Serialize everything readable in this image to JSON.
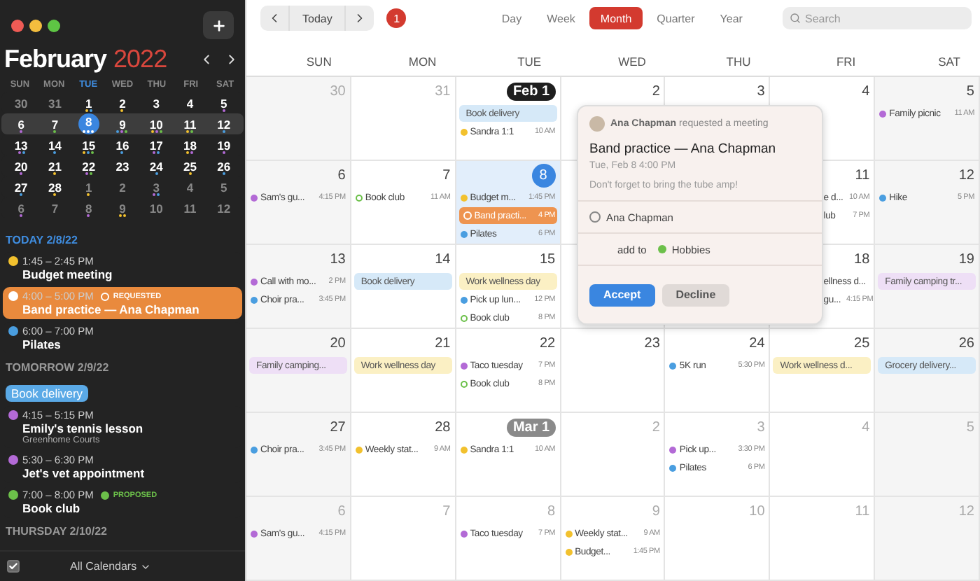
{
  "sidebar": {
    "month": "February",
    "year": "2022",
    "weekdays": [
      {
        "label": "SUN",
        "selected": false
      },
      {
        "label": "MON",
        "selected": false
      },
      {
        "label": "TUE",
        "selected": true
      },
      {
        "label": "WED",
        "selected": false
      },
      {
        "label": "THU",
        "selected": false
      },
      {
        "label": "FRI",
        "selected": false
      },
      {
        "label": "SAT",
        "selected": false
      }
    ],
    "weeks": [
      {
        "current": false,
        "days": [
          {
            "n": "30",
            "dim": true,
            "selected": false
          },
          {
            "n": "31",
            "dim": true,
            "selected": false
          },
          {
            "n": "1",
            "dim": false,
            "selected": false,
            "dots": [
              {
                "color": "#f2c12e"
              },
              {
                "color": "#4a9ee0"
              }
            ]
          },
          {
            "n": "2",
            "dim": false,
            "selected": false,
            "dots": [
              {
                "color": "#f2c12e"
              }
            ]
          },
          {
            "n": "3",
            "dim": false,
            "selected": false
          },
          {
            "n": "4",
            "dim": false,
            "selected": false
          },
          {
            "n": "5",
            "dim": false,
            "selected": false,
            "dots": [
              {
                "color": "#b36ad6"
              }
            ]
          }
        ]
      },
      {
        "current": true,
        "days": [
          {
            "n": "6",
            "dim": false,
            "selected": false,
            "dots": [
              {
                "color": "#b36ad6"
              }
            ]
          },
          {
            "n": "7",
            "dim": false,
            "selected": false,
            "dots": [
              {
                "color": "#6cc04a"
              }
            ]
          },
          {
            "n": "8",
            "dim": false,
            "selected": true,
            "dots": [
              {
                "color": "#ffffff"
              },
              {
                "color": "#ffffff"
              },
              {
                "color": "#ffffff"
              }
            ]
          },
          {
            "n": "9",
            "dim": false,
            "selected": false,
            "dots": [
              {
                "color": "#4a9ee0"
              },
              {
                "color": "#b36ad6"
              },
              {
                "color": "#6cc04a"
              }
            ]
          },
          {
            "n": "10",
            "dim": false,
            "selected": false,
            "dots": [
              {
                "color": "#f2c12e"
              },
              {
                "color": "#b36ad6"
              },
              {
                "color": "#6cc04a"
              }
            ]
          },
          {
            "n": "11",
            "dim": false,
            "selected": false,
            "dots": [
              {
                "color": "#f2c12e"
              },
              {
                "color": "#6cc04a"
              }
            ]
          },
          {
            "n": "12",
            "dim": false,
            "selected": false,
            "dots": [
              {
                "color": "#4a9ee0"
              }
            ]
          }
        ]
      },
      {
        "current": false,
        "days": [
          {
            "n": "13",
            "dim": false,
            "selected": false,
            "dots": [
              {
                "color": "#b36ad6"
              },
              {
                "color": "#4a9ee0"
              }
            ]
          },
          {
            "n": "14",
            "dim": false,
            "selected": false,
            "dots": [
              {
                "color": "#4a9ee0"
              }
            ]
          },
          {
            "n": "15",
            "dim": false,
            "selected": false,
            "dots": [
              {
                "color": "#f2c12e"
              },
              {
                "color": "#4a9ee0"
              },
              {
                "color": "#6cc04a"
              }
            ]
          },
          {
            "n": "16",
            "dim": false,
            "selected": false,
            "dots": [
              {
                "color": "#4a9ee0"
              }
            ]
          },
          {
            "n": "17",
            "dim": false,
            "selected": false,
            "dots": [
              {
                "color": "#b36ad6"
              },
              {
                "color": "#4a9ee0"
              }
            ]
          },
          {
            "n": "18",
            "dim": false,
            "selected": false,
            "dots": [
              {
                "color": "#f2c12e"
              },
              {
                "color": "#b36ad6"
              }
            ]
          },
          {
            "n": "19",
            "dim": false,
            "selected": false,
            "dots": [
              {
                "color": "#b36ad6"
              }
            ]
          }
        ]
      },
      {
        "current": false,
        "days": [
          {
            "n": "20",
            "dim": false,
            "selected": false,
            "dots": [
              {
                "color": "#b36ad6"
              }
            ]
          },
          {
            "n": "21",
            "dim": false,
            "selected": false,
            "dots": [
              {
                "color": "#f2c12e"
              }
            ]
          },
          {
            "n": "22",
            "dim": false,
            "selected": false,
            "dots": [
              {
                "color": "#b36ad6"
              },
              {
                "color": "#6cc04a"
              }
            ]
          },
          {
            "n": "23",
            "dim": false,
            "selected": false
          },
          {
            "n": "24",
            "dim": false,
            "selected": false,
            "dots": [
              {
                "color": "#4a9ee0"
              }
            ]
          },
          {
            "n": "25",
            "dim": false,
            "selected": false,
            "dots": [
              {
                "color": "#f2c12e"
              }
            ]
          },
          {
            "n": "26",
            "dim": false,
            "selected": false,
            "dots": [
              {
                "color": "#4a9ee0"
              }
            ]
          }
        ]
      },
      {
        "current": false,
        "days": [
          {
            "n": "27",
            "dim": false,
            "selected": false,
            "dots": [
              {
                "color": "#4a9ee0"
              }
            ]
          },
          {
            "n": "28",
            "dim": false,
            "selected": false,
            "dots": [
              {
                "color": "#f2c12e"
              }
            ]
          },
          {
            "n": "1",
            "dim": true,
            "selected": false,
            "dots": [
              {
                "color": "#f2c12e"
              }
            ]
          },
          {
            "n": "2",
            "dim": true,
            "selected": false
          },
          {
            "n": "3",
            "dim": true,
            "selected": false,
            "dots": [
              {
                "color": "#b36ad6"
              },
              {
                "color": "#4a9ee0"
              }
            ]
          },
          {
            "n": "4",
            "dim": true,
            "selected": false
          },
          {
            "n": "5",
            "dim": true,
            "selected": false
          }
        ]
      },
      {
        "current": false,
        "days": [
          {
            "n": "6",
            "dim": true,
            "selected": false,
            "dots": [
              {
                "color": "#b36ad6"
              }
            ]
          },
          {
            "n": "7",
            "dim": true,
            "selected": false
          },
          {
            "n": "8",
            "dim": true,
            "selected": false,
            "dots": [
              {
                "color": "#b36ad6"
              }
            ]
          },
          {
            "n": "9",
            "dim": true,
            "selected": false,
            "dots": [
              {
                "color": "#f2c12e"
              },
              {
                "color": "#f2c12e"
              }
            ]
          },
          {
            "n": "10",
            "dim": true,
            "selected": false
          },
          {
            "n": "11",
            "dim": true,
            "selected": false
          },
          {
            "n": "12",
            "dim": true,
            "selected": false
          }
        ]
      }
    ],
    "agenda": [
      {
        "heading": "TODAY 2/8/22",
        "today": true,
        "items": [
          {
            "kind": "event",
            "selected": false,
            "time": "1:45 – 2:45 PM",
            "title": "Budget meeting",
            "color": "#f2c12e"
          },
          {
            "kind": "event",
            "selected": true,
            "time": "4:00 – 5:00 PM",
            "badge": {
              "kind": "requested",
              "label": "REQUESTED"
            },
            "title": "Band practice — Ana Chapman",
            "color": "#ffffff"
          },
          {
            "kind": "event",
            "selected": false,
            "time": "6:00 – 7:00 PM",
            "title": "Pilates",
            "color": "#4a9ee0"
          }
        ]
      },
      {
        "heading": "TOMORROW 2/9/22",
        "today": false,
        "items": [
          {
            "kind": "pill",
            "title": "Book delivery",
            "color": "#5aa9e6"
          },
          {
            "kind": "event",
            "selected": false,
            "time": "4:15 – 5:15 PM",
            "title": "Emily's tennis lesson",
            "note": "Greenhome Courts",
            "color": "#b36ad6"
          },
          {
            "kind": "event",
            "selected": false,
            "time": "5:30 – 6:30 PM",
            "title": "Jet's vet appointment",
            "color": "#b36ad6"
          },
          {
            "kind": "event",
            "selected": false,
            "time": "7:00 – 8:00 PM",
            "badge": {
              "kind": "proposed",
              "label": "PROPOSED"
            },
            "title": "Book club",
            "color": "#6cc04a"
          }
        ]
      },
      {
        "heading": "THURSDAY 2/10/22",
        "today": false
      }
    ],
    "footer": {
      "label": "All Calendars",
      "checked": true
    }
  },
  "toolbar": {
    "today": "Today",
    "notifications": "1",
    "views": [
      {
        "label": "Day",
        "selected": false
      },
      {
        "label": "Week",
        "selected": false
      },
      {
        "label": "Month",
        "selected": true
      },
      {
        "label": "Quarter",
        "selected": false
      },
      {
        "label": "Year",
        "selected": false
      }
    ],
    "search": {
      "placeholder": "Search"
    }
  },
  "calendar": {
    "weekdays": [
      "SUN",
      "MON",
      "TUE",
      "WED",
      "THU",
      "FRI",
      "SAT"
    ],
    "weeks": [
      {
        "cells": [
          {
            "kind": "plain",
            "n": "30",
            "dim": true,
            "today": false
          },
          {
            "kind": "plain",
            "n": "31",
            "dim": true,
            "today": false
          },
          {
            "kind": "month",
            "n": "Feb 1",
            "today": false,
            "events": [
              {
                "kind": "pill",
                "title": "Book delivery",
                "color": "#d6e9f8"
              },
              {
                "kind": "dot",
                "title": "Sandra 1:1",
                "time": "10 AM",
                "color": "#f2c12e"
              }
            ]
          },
          {
            "kind": "plain",
            "n": "2",
            "dim": false,
            "today": false
          },
          {
            "kind": "plain",
            "n": "3",
            "dim": false,
            "today": false
          },
          {
            "kind": "plain",
            "n": "4",
            "dim": false,
            "today": false
          },
          {
            "kind": "plain",
            "n": "5",
            "dim": false,
            "today": false,
            "events": [
              {
                "kind": "dot",
                "title": "Family picnic",
                "time": "11 AM",
                "color": "#b36ad6"
              }
            ]
          }
        ]
      },
      {
        "cells": [
          {
            "kind": "plain",
            "n": "6",
            "dim": false,
            "today": false,
            "events": [
              {
                "kind": "dot",
                "title": "Sam's gu...",
                "time": "4:15 PM",
                "color": "#b36ad6"
              }
            ]
          },
          {
            "kind": "plain",
            "n": "7",
            "dim": false,
            "today": false,
            "events": [
              {
                "kind": "ring",
                "title": "Book club",
                "time": "11 AM",
                "color": "#6cc04a"
              }
            ]
          },
          {
            "kind": "today",
            "n": "8",
            "today": true,
            "events": [
              {
                "kind": "dot",
                "title": "Budget m...",
                "time": "1:45 PM",
                "color": "#f2c12e"
              },
              {
                "kind": "selected",
                "title": "Band practi...",
                "time": "4 PM",
                "color": "#ee9450"
              },
              {
                "kind": "dot",
                "title": "Pilates",
                "time": "6 PM",
                "color": "#4a9ee0"
              }
            ]
          },
          {
            "kind": "covered"
          },
          {
            "kind": "hidden"
          },
          {
            "kind": "plain",
            "n": "11",
            "dim": false,
            "today": false,
            "events": [
              {
                "kind": "clipped",
                "title": "e d...",
                "time": "10 AM"
              },
              {
                "kind": "clipped",
                "title": "lub",
                "time": "7 PM"
              }
            ]
          },
          {
            "kind": "plain",
            "n": "12",
            "dim": false,
            "today": false,
            "events": [
              {
                "kind": "dot",
                "title": "Hike",
                "time": "5 PM",
                "color": "#4a9ee0"
              }
            ]
          }
        ]
      },
      {
        "cells": [
          {
            "kind": "plain",
            "n": "13",
            "dim": false,
            "today": false,
            "events": [
              {
                "kind": "dot",
                "title": "Call with mo...",
                "time": "2 PM",
                "color": "#b36ad6"
              },
              {
                "kind": "dot",
                "title": "Choir pra...",
                "time": "3:45 PM",
                "color": "#4a9ee0"
              }
            ]
          },
          {
            "kind": "plain",
            "n": "14",
            "dim": false,
            "today": false,
            "events": [
              {
                "kind": "pill",
                "title": "Book delivery",
                "color": "#d6e9f8"
              }
            ]
          },
          {
            "kind": "plain",
            "n": "15",
            "dim": false,
            "today": false,
            "events": [
              {
                "kind": "pill",
                "title": "Work wellness day",
                "color": "#fbf0c4"
              },
              {
                "kind": "dot",
                "title": "Pick up lun...",
                "time": "12 PM",
                "color": "#4a9ee0"
              },
              {
                "kind": "ring",
                "title": "Book club",
                "time": "8 PM",
                "color": "#6cc04a"
              }
            ]
          },
          {
            "kind": "covered"
          },
          {
            "kind": "covered"
          },
          {
            "kind": "plain",
            "n": "18",
            "dim": false,
            "today": false,
            "events": [
              {
                "kind": "clipped",
                "title": "ellness d..."
              },
              {
                "kind": "clipped",
                "title": "gu...",
                "time": "4:15 PM"
              }
            ]
          },
          {
            "kind": "plain",
            "n": "19",
            "dim": false,
            "today": false,
            "events": [
              {
                "kind": "pill",
                "title": "Family camping tr...",
                "color": "#eedff6"
              }
            ]
          }
        ]
      },
      {
        "cells": [
          {
            "kind": "plain",
            "n": "20",
            "dim": false,
            "today": false,
            "events": [
              {
                "kind": "pill",
                "title": "Family camping...",
                "color": "#eedff6"
              }
            ]
          },
          {
            "kind": "plain",
            "n": "21",
            "dim": false,
            "today": false,
            "events": [
              {
                "kind": "pill",
                "title": "Work wellness day",
                "color": "#fbf0c4"
              }
            ]
          },
          {
            "kind": "plain",
            "n": "22",
            "dim": false,
            "today": false,
            "events": [
              {
                "kind": "dot",
                "title": "Taco tuesday",
                "time": "7 PM",
                "color": "#b36ad6"
              },
              {
                "kind": "ring",
                "title": "Book club",
                "time": "8 PM",
                "color": "#6cc04a"
              }
            ]
          },
          {
            "kind": "plain",
            "n": "23",
            "dim": false,
            "today": false
          },
          {
            "kind": "plain",
            "n": "24",
            "dim": false,
            "today": false,
            "events": [
              {
                "kind": "dot",
                "title": "5K run",
                "time": "5:30 PM",
                "color": "#4a9ee0"
              }
            ]
          },
          {
            "kind": "plain",
            "n": "25",
            "dim": false,
            "today": false,
            "events": [
              {
                "kind": "pill",
                "title": "Work wellness d...",
                "color": "#fbf0c4"
              }
            ]
          },
          {
            "kind": "plain",
            "n": "26",
            "dim": false,
            "today": false,
            "events": [
              {
                "kind": "pill",
                "title": "Grocery delivery...",
                "color": "#d6e9f8"
              }
            ]
          }
        ]
      },
      {
        "cells": [
          {
            "kind": "plain",
            "n": "27",
            "dim": false,
            "today": false,
            "events": [
              {
                "kind": "dot",
                "title": "Choir pra...",
                "time": "3:45 PM",
                "color": "#4a9ee0"
              }
            ]
          },
          {
            "kind": "plain",
            "n": "28",
            "dim": false,
            "today": false,
            "events": [
              {
                "kind": "dot",
                "title": "Weekly stat...",
                "time": "9 AM",
                "color": "#f2c12e"
              }
            ]
          },
          {
            "kind": "month-next",
            "n": "Mar 1",
            "today": false,
            "events": [
              {
                "kind": "dot",
                "title": "Sandra 1:1",
                "time": "10 AM",
                "color": "#f2c12e"
              }
            ]
          },
          {
            "kind": "plain",
            "n": "2",
            "dim": true,
            "today": false
          },
          {
            "kind": "plain",
            "n": "3",
            "dim": true,
            "today": false,
            "events": [
              {
                "kind": "dot",
                "title": "Pick up...",
                "time": "3:30 PM",
                "color": "#b36ad6"
              },
              {
                "kind": "dot",
                "title": "Pilates",
                "time": "6 PM",
                "color": "#4a9ee0"
              }
            ]
          },
          {
            "kind": "plain",
            "n": "4",
            "dim": true,
            "today": false
          },
          {
            "kind": "plain",
            "n": "5",
            "dim": true,
            "today": false
          }
        ]
      },
      {
        "cells": [
          {
            "kind": "plain",
            "n": "6",
            "dim": true,
            "today": false,
            "events": [
              {
                "kind": "dot",
                "title": "Sam's gu...",
                "time": "4:15 PM",
                "color": "#b36ad6"
              }
            ]
          },
          {
            "kind": "plain",
            "n": "7",
            "dim": true,
            "today": false
          },
          {
            "kind": "plain",
            "n": "8",
            "dim": true,
            "today": false,
            "events": [
              {
                "kind": "dot",
                "title": "Taco tuesday",
                "time": "7 PM",
                "color": "#b36ad6"
              }
            ]
          },
          {
            "kind": "plain",
            "n": "9",
            "dim": true,
            "today": false,
            "events": [
              {
                "kind": "dot",
                "title": "Weekly stat...",
                "time": "9 AM",
                "color": "#f2c12e"
              },
              {
                "kind": "dot",
                "title": "Budget...",
                "time": "1:45 PM",
                "color": "#f2c12e"
              }
            ]
          },
          {
            "kind": "plain",
            "n": "10",
            "dim": true,
            "today": false
          },
          {
            "kind": "plain",
            "n": "11",
            "dim": true,
            "today": false
          },
          {
            "kind": "plain",
            "n": "12",
            "dim": true,
            "today": false
          }
        ]
      }
    ]
  },
  "popup": {
    "header": "**Ana Chapman** requested a meeting",
    "title": "Band practice — Ana Chapman",
    "when": "Tue, Feb 8 4:00 PM",
    "note": "Don't forget to bring the tube amp!",
    "attendee": "Ana Chapman",
    "add_to_label": "add to",
    "calendar": {
      "name": "Hobbies",
      "color": "#6cc04a"
    },
    "accept": "Accept",
    "decline": "Decline"
  }
}
